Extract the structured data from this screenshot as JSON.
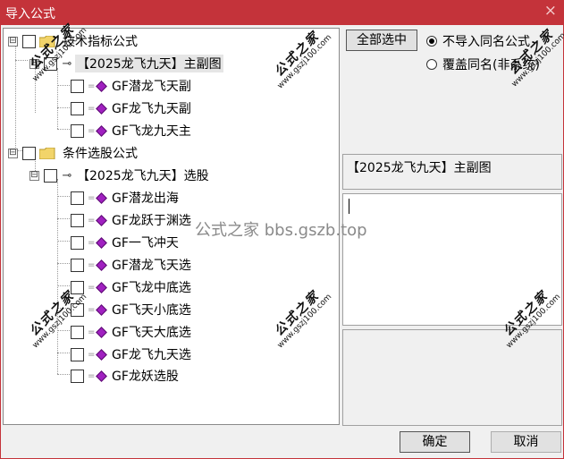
{
  "window": {
    "title": "导入公式",
    "close_glyph": "×",
    "title_bar_color": "#c4333a"
  },
  "tree": {
    "group1": {
      "label": "技术指标公式",
      "child": {
        "label": "【2025龙飞九天】主副图",
        "items": [
          "GF潜龙飞天副",
          "GF龙飞九天副",
          "GF飞龙九天主"
        ]
      }
    },
    "group2": {
      "label": "条件选股公式",
      "child": {
        "label": "【2025龙飞九天】选股",
        "items": [
          "GF潜龙出海",
          "GF龙跃于渊选",
          "GF一飞冲天",
          "GF潜龙飞天选",
          "GF飞龙中底选",
          "GF飞天小底选",
          "GF飞天大底选",
          "GF龙飞九天选",
          "GF龙妖选股"
        ]
      }
    },
    "expander_symbol": "⊟",
    "link_symbol": "⊸"
  },
  "controls": {
    "select_all": "全部选中",
    "radio_skip": "不导入同名公式",
    "radio_overwrite": "覆盖同名(非系统)",
    "selected_option": "radio_skip"
  },
  "info": {
    "formula_name": "【2025龙飞九天】主副图",
    "description": "",
    "notes": ""
  },
  "footer": {
    "ok": "确定",
    "cancel": "取消"
  },
  "watermarks": {
    "site_text": "公式之家",
    "site_url": "www.gszj100.com",
    "center_text": "公式之家 bbs.gszb.top"
  }
}
